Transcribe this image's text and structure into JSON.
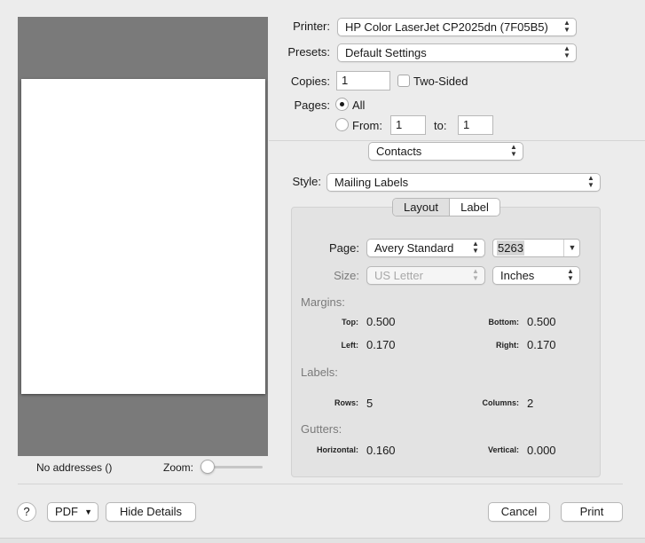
{
  "preview": {
    "status_text": "No addresses ()",
    "zoom_label": "Zoom:",
    "zoom_level": 0
  },
  "printer": {
    "label": "Printer:",
    "value": "HP Color LaserJet CP2025dn (7F05B5)"
  },
  "presets": {
    "label": "Presets:",
    "value": "Default Settings"
  },
  "copies": {
    "label": "Copies:",
    "value": "1",
    "two_sided_label": "Two-Sided",
    "two_sided_checked": false
  },
  "pages": {
    "label": "Pages:",
    "all_label": "All",
    "from_label": "From:",
    "from_value": "1",
    "to_label": "to:",
    "to_value": "1",
    "selected": "All"
  },
  "panel_select": {
    "value": "Contacts"
  },
  "style": {
    "label": "Style:",
    "value": "Mailing Labels"
  },
  "tabs": [
    {
      "label": "Layout",
      "selected": true
    },
    {
      "label": "Label",
      "selected": false
    }
  ],
  "layout": {
    "page_label": "Page:",
    "page_vendor": "Avery Standard",
    "page_code": "5263",
    "size_label": "Size:",
    "size_value": "US Letter",
    "units_value": "Inches",
    "margins_title": "Margins:",
    "top_label": "Top:",
    "top_value": "0.500",
    "bottom_label": "Bottom:",
    "bottom_value": "0.500",
    "left_label": "Left:",
    "left_value": "0.170",
    "right_label": "Right:",
    "right_value": "0.170",
    "labels_title": "Labels:",
    "rows_label": "Rows:",
    "rows_value": "5",
    "columns_label": "Columns:",
    "columns_value": "2",
    "gutters_title": "Gutters:",
    "horizontal_label": "Horizontal:",
    "horizontal_value": "0.160",
    "vertical_label": "Vertical:",
    "vertical_value": "0.000"
  },
  "footer": {
    "help_label": "?",
    "pdf_label": "PDF",
    "hide_details_label": "Hide Details",
    "cancel_label": "Cancel",
    "print_label": "Print"
  }
}
